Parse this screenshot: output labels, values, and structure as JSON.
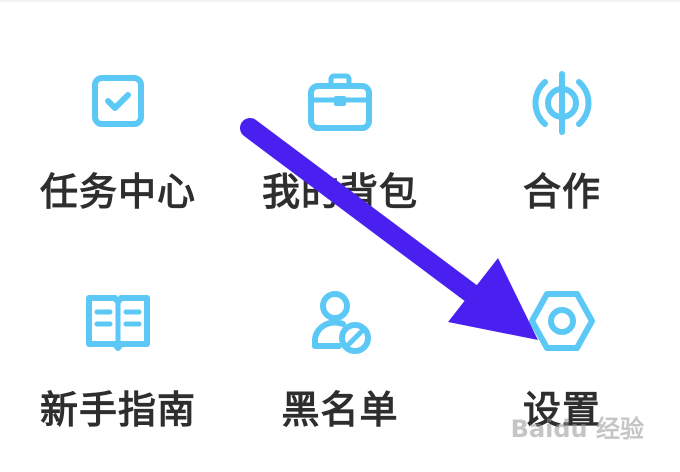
{
  "menu": {
    "items": [
      {
        "label": "任务中心",
        "icon": "task-checkbox-icon"
      },
      {
        "label": "我的背包",
        "icon": "briefcase-icon"
      },
      {
        "label": "合作",
        "icon": "cooperation-icon"
      },
      {
        "label": "新手指南",
        "icon": "book-icon"
      },
      {
        "label": "黑名单",
        "icon": "blocked-user-icon"
      },
      {
        "label": "设置",
        "icon": "settings-nut-icon"
      }
    ]
  },
  "watermark": "Baidu 经验",
  "colors": {
    "icon": "#5bc8f5",
    "label": "#2e2e2e",
    "arrow": "#4a20f0"
  }
}
